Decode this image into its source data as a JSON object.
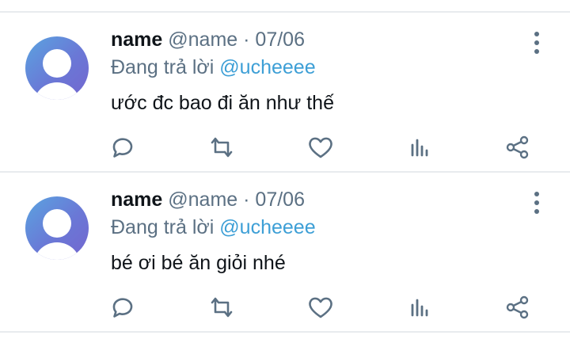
{
  "tweets": [
    {
      "display_name": "name",
      "handle": "@name",
      "separator": "·",
      "date": "07/06",
      "reply_prefix": "Đang trả lời",
      "reply_to": "@ucheeee",
      "text": "ước đc bao đi ăn như thế"
    },
    {
      "display_name": "name",
      "handle": "@name",
      "separator": "·",
      "date": "07/06",
      "reply_prefix": "Đang trả lời",
      "reply_to": "@ucheeee",
      "text": "bé ơi bé ăn giỏi nhé"
    }
  ],
  "icons": {
    "avatar": "default-user-avatar",
    "more": "more-vertical-icon",
    "reply": "reply-icon",
    "retweet": "retweet-icon",
    "like": "heart-icon",
    "stats": "analytics-icon",
    "share": "share-icon"
  },
  "colors": {
    "text": "#0f1419",
    "muted": "#5b7083",
    "mention": "#3d9fd6",
    "divider": "#e8ebee",
    "avatar_gradient": [
      "#5aa4e0",
      "#7466cf"
    ]
  }
}
